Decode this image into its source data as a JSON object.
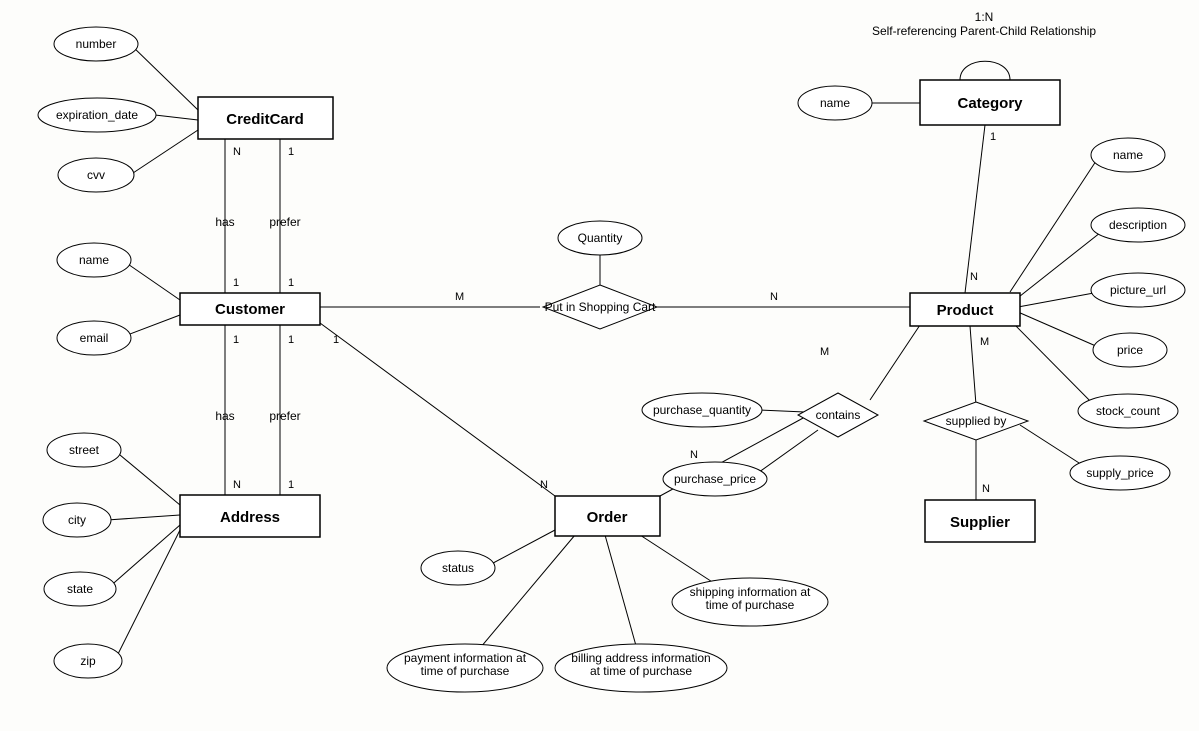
{
  "notes": {
    "self_ref": "1:N\nSelf-referencing Parent-Child Relationship"
  },
  "entities": {
    "creditcard": "CreditCard",
    "customer": "Customer",
    "address": "Address",
    "category": "Category",
    "product": "Product",
    "order": "Order",
    "supplier": "Supplier"
  },
  "attributes": {
    "cc_number": "number",
    "cc_expiration": "expiration_date",
    "cc_cvv": "cvv",
    "cust_name": "name",
    "cust_email": "email",
    "addr_street": "street",
    "addr_city": "city",
    "addr_state": "state",
    "addr_zip": "zip",
    "cat_name": "name",
    "prod_name": "name",
    "prod_description": "description",
    "prod_picture_url": "picture_url",
    "prod_price": "price",
    "prod_stock_count": "stock_count",
    "cart_quantity": "Quantity",
    "contains_qty": "purchase_quantity",
    "contains_price": "purchase_price",
    "supplied_price": "supply_price",
    "order_status": "status",
    "order_payment": "payment information at\ntime of purchase",
    "order_billing": "billing address information\nat time of purchase",
    "order_shipping": "shipping information at\ntime of purchase"
  },
  "relationships": {
    "cc_has": "has",
    "cc_prefer": "prefer",
    "addr_has": "has",
    "addr_prefer": "prefer",
    "put_cart": "Put in Shopping Cart",
    "contains": "contains",
    "supplied_by": "supplied by"
  },
  "cardinalities": {
    "cc_has_top": "N",
    "cc_has_bot": "1",
    "cc_prefer_top": "1",
    "cc_prefer_bot": "1",
    "addr_has_top": "1",
    "addr_has_bot": "N",
    "addr_prefer_top": "1",
    "addr_prefer_bot": "1",
    "cust_order_top": "1",
    "cust_order_bot": "N",
    "cart_M": "M",
    "cart_N": "N",
    "cat_prod_top": "1",
    "cat_prod_bot": "N",
    "contains_M": "M",
    "contains_N": "N",
    "supplied_M": "M",
    "supplied_N": "N"
  }
}
